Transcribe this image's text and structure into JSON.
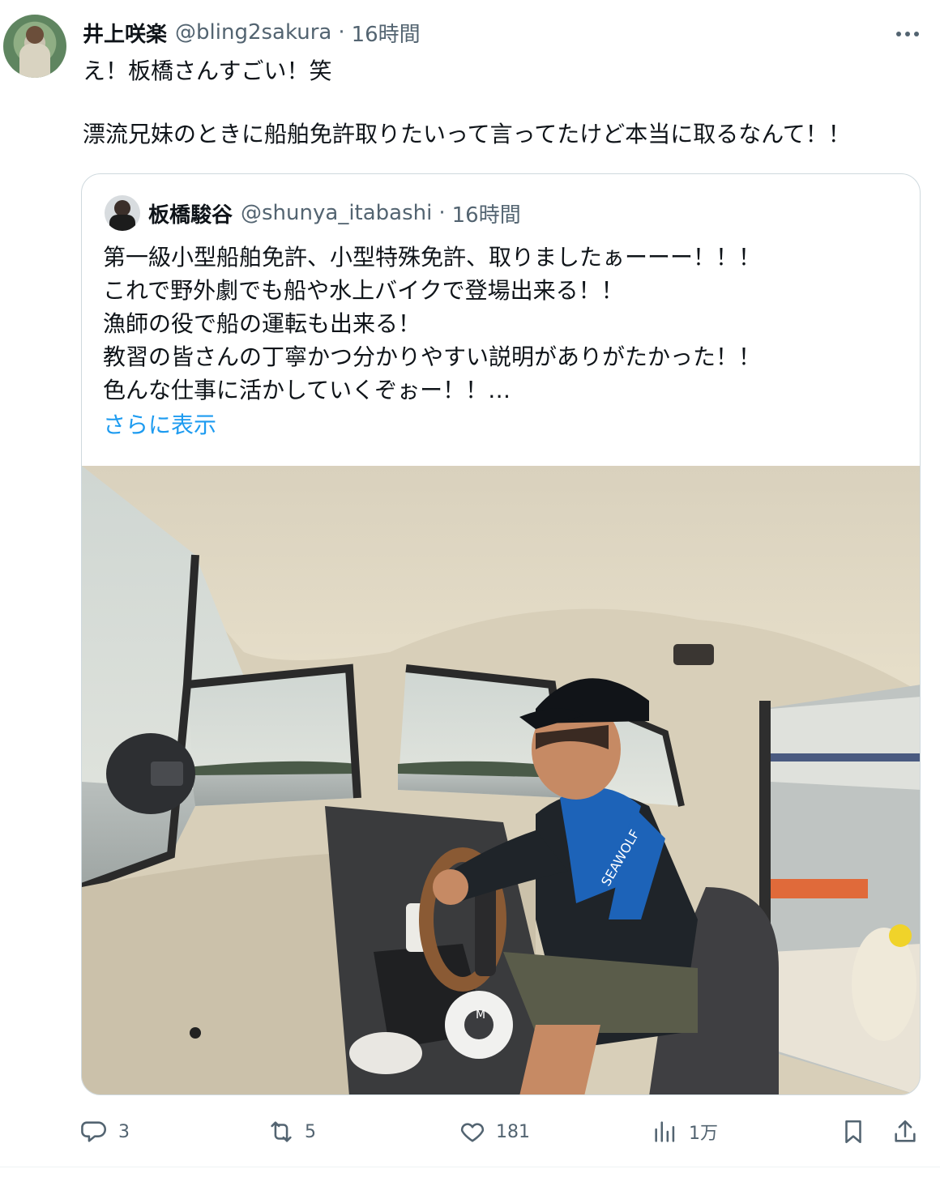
{
  "tweet": {
    "author_name": "井上咲楽",
    "author_handle": "@bling2sakura",
    "separator": "·",
    "time": "16時間",
    "text_line1": "え！板橋さんすごい！笑",
    "text_line2": "漂流兄妹のときに船舶免許取りたいって言ってたけど本当に取るなんて！！"
  },
  "quote": {
    "author_name": "板橋駿谷",
    "author_handle": "@shunya_itabashi",
    "separator": "·",
    "time": "16時間",
    "lines": [
      "第一級小型船舶免許、小型特殊免許、取りましたぁーーー！！！",
      "これで野外劇でも船や水上バイクで登場出来る！！",
      "漁師の役で船の運転も出来る！",
      "教習の皆さんの丁寧かつ分かりやすい説明がありがたかった！！",
      "色んな仕事に活かしていくぞぉー！！…"
    ],
    "show_more": "さらに表示"
  },
  "photo_boat": {
    "life_vest_text": "SEAWOLF",
    "helm_label": "M"
  },
  "actions": {
    "reply_count": "3",
    "retweet_count": "5",
    "like_count": "181",
    "views_count": "1万"
  },
  "icons": {
    "reply": "speech-bubble-icon",
    "retweet": "retweet-icon",
    "like": "heart-icon",
    "views": "bar-chart-icon",
    "bookmark": "bookmark-icon",
    "share": "share-icon",
    "more": "more-dots-icon"
  },
  "colors": {
    "text": "#0f1419",
    "secondary": "#536471",
    "link": "#1d9bf0",
    "border": "#cfd9de"
  }
}
